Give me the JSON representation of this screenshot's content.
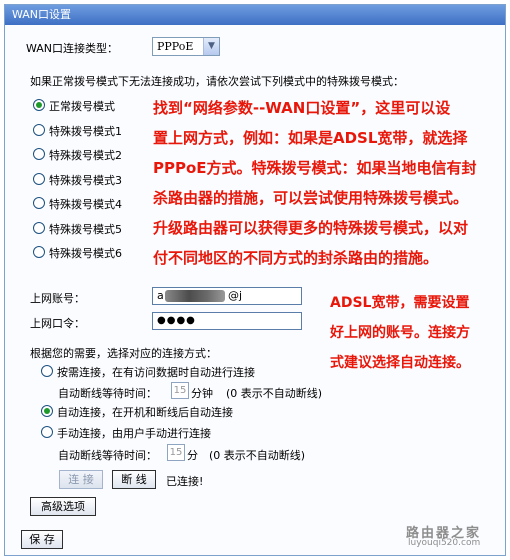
{
  "window": {
    "title": "WAN口设置"
  },
  "connection_type": {
    "label": "WAN口连接类型：",
    "selected": "PPPoE"
  },
  "hint": "如果正常拨号模式下无法连接成功，请依次尝试下列模式中的特殊拨号模式：",
  "dial_modes": [
    {
      "label": "正常拨号模式",
      "checked": true
    },
    {
      "label": "特殊拨号模式1",
      "checked": false
    },
    {
      "label": "特殊拨号模式2",
      "checked": false
    },
    {
      "label": "特殊拨号模式3",
      "checked": false
    },
    {
      "label": "特殊拨号模式4",
      "checked": false
    },
    {
      "label": "特殊拨号模式5",
      "checked": false
    },
    {
      "label": "特殊拨号模式6",
      "checked": false
    }
  ],
  "account": {
    "label": "上网账号：",
    "value_start": "a",
    "value_end": "@j"
  },
  "password": {
    "label": "上网口令：",
    "value": "●●●●"
  },
  "connect_section": {
    "title": "根据您的需要，选择对应的连接方式：",
    "on_demand": "按需连接，在有访问数据时自动进行连接",
    "auto_disconnect_label": "自动断线等待时间：",
    "on_demand_wait": "15",
    "on_demand_unit": "分钟",
    "on_demand_note": "(0 表示不自动断线)",
    "auto": "自动连接，在开机和断线后自动连接",
    "manual": "手动连接，由用户手动进行连接",
    "manual_wait": "15",
    "manual_unit": "分",
    "manual_note": "(0 表示不自动断线)"
  },
  "buttons": {
    "connect": "连 接",
    "disconnect": "断 线",
    "status": "已连接!",
    "advanced": "高级选项",
    "save": "保 存"
  },
  "annotations": {
    "main": [
      "找到“网络参数--WAN口设置”，这里可以设",
      "置上网方式，例如：如果是ADSL宽带，就选择",
      "PPPoE方式。特殊拨号模式：如果当地电信有封",
      "杀路由器的措施，可以尝试使用特殊拨号模式。",
      "升级路由器可以获得更多的特殊拨号模式，以对",
      "付不同地区的不同方式的封杀路由的措施。"
    ],
    "account": [
      "ADSL宽带，需要设置",
      "好上网的账号。连接方",
      "式建议选择自动连接。"
    ]
  },
  "watermark": {
    "name": "路由器之家",
    "url": "luyouqi520.com"
  }
}
